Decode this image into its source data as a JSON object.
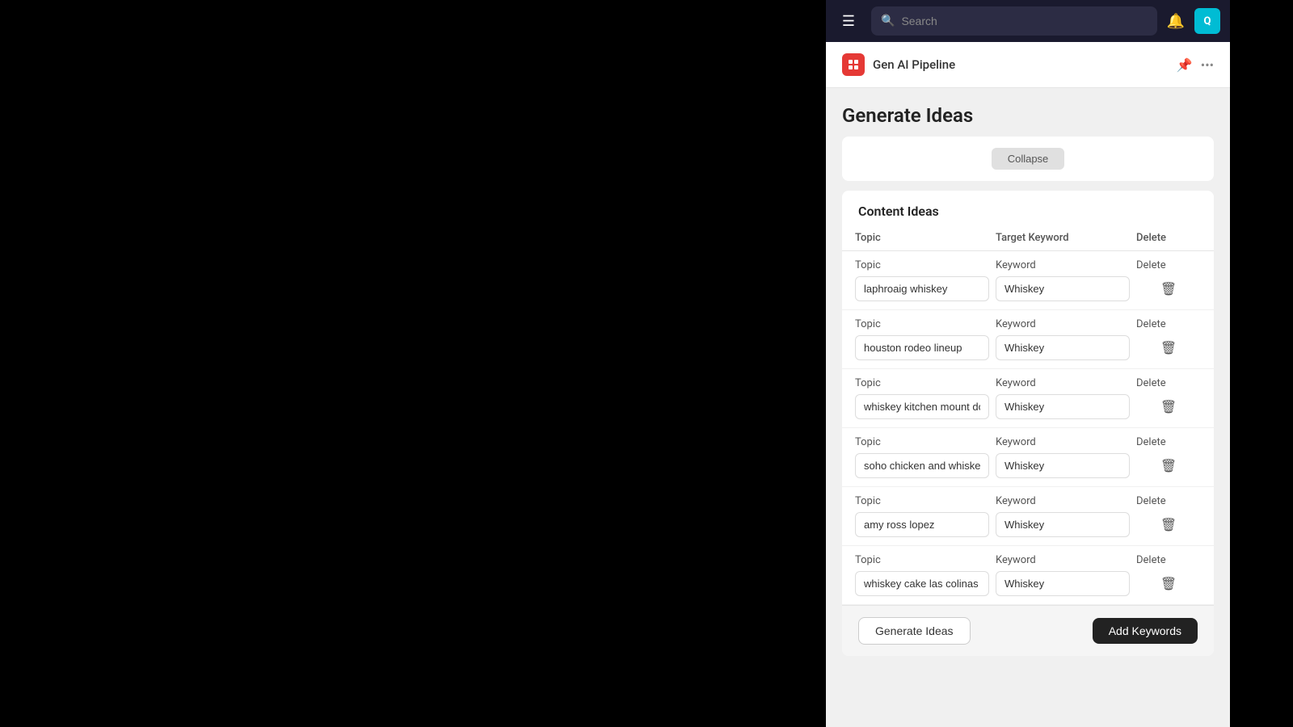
{
  "nav": {
    "search_placeholder": "Search",
    "avatar_text": "Q",
    "avatar_bg": "#00bcd4"
  },
  "app": {
    "logo_text": "⠿",
    "name": "Gen AI Pipeline",
    "page_title": "Generate Ideas"
  },
  "content_ideas": {
    "section_title": "Content Ideas",
    "col_headers": {
      "topic": "Topic",
      "keyword": "Target Keyword",
      "delete": "Delete"
    },
    "rows": [
      {
        "topic_label": "Topic",
        "keyword_label": "Keyword",
        "topic": "laphroaig whiskey",
        "keyword": "Whiskey",
        "delete_label": "Delete"
      },
      {
        "topic_label": "Topic",
        "keyword_label": "Keyword",
        "topic": "houston rodeo lineup",
        "keyword": "Whiskey",
        "delete_label": "Delete"
      },
      {
        "topic_label": "Topic",
        "keyword_label": "Keyword",
        "topic": "whiskey kitchen mount dora",
        "keyword": "Whiskey",
        "delete_label": "Delete"
      },
      {
        "topic_label": "Topic",
        "keyword_label": "Keyword",
        "topic": "soho chicken and whiskey",
        "keyword": "Whiskey",
        "delete_label": "Delete"
      },
      {
        "topic_label": "Topic",
        "keyword_label": "Keyword",
        "topic": "amy ross lopez",
        "keyword": "Whiskey",
        "delete_label": "Delete"
      },
      {
        "topic_label": "Topic",
        "keyword_label": "Keyword",
        "topic": "whiskey cake las colinas",
        "keyword": "Whiskey",
        "delete_label": "Delete"
      }
    ]
  },
  "footer": {
    "generate_label": "Generate Ideas",
    "add_keywords_label": "Add Keywords"
  }
}
